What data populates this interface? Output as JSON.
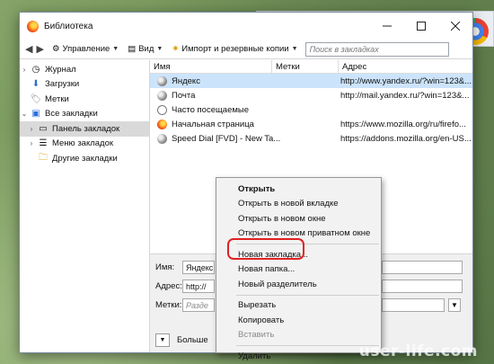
{
  "window": {
    "title": "Библиотека"
  },
  "toolbar": {
    "manage": "Управление",
    "view": "Вид",
    "import": "Импорт и резервные копии",
    "search_placeholder": "Поиск в закладках"
  },
  "sidebar": {
    "items": [
      {
        "label": "Журнал"
      },
      {
        "label": "Загрузки"
      },
      {
        "label": "Метки"
      },
      {
        "label": "Все закладки"
      },
      {
        "label": "Панель закладок"
      },
      {
        "label": "Меню закладок"
      },
      {
        "label": "Другие закладки"
      }
    ]
  },
  "table": {
    "headers": [
      "Имя",
      "Метки",
      "Адрес"
    ],
    "rows": [
      {
        "name": "Яндекс",
        "url": "http://www.yandex.ru/?win=123&..."
      },
      {
        "name": "Почта",
        "url": "http://mail.yandex.ru/?win=123&..."
      },
      {
        "name": "Часто посещаемые",
        "url": ""
      },
      {
        "name": "Начальная страница",
        "url": "https://www.mozilla.org/ru/firefo..."
      },
      {
        "name": "Speed Dial [FVD] - New Ta...",
        "url": "https://addons.mozilla.org/en-US..."
      }
    ]
  },
  "details": {
    "name_label": "Имя:",
    "name_value": "Яндекс",
    "address_label": "Адрес:",
    "address_value": "http://",
    "tags_label": "Метки:",
    "tags_placeholder": "Разде",
    "more_label": "Больше"
  },
  "context_menu": {
    "items": [
      "Открыть",
      "Открыть в новой вкладке",
      "Открыть в новом окне",
      "Открыть в новом приватном окне",
      "Новая закладка...",
      "Новая папка...",
      "Новый разделитель",
      "Вырезать",
      "Копировать",
      "Вставить",
      "Удалить"
    ]
  },
  "watermark": "user-life.com"
}
